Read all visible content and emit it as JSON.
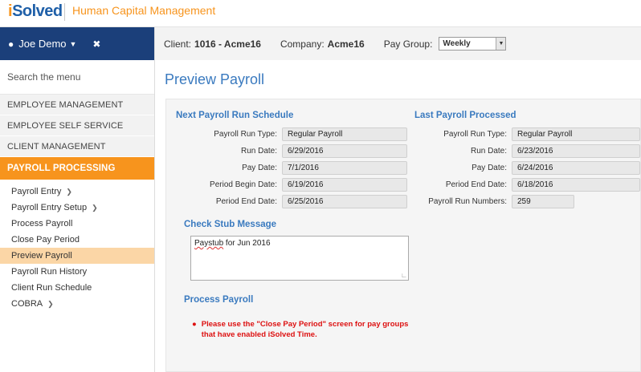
{
  "header": {
    "logo_i": "i",
    "logo_rest": "Solved",
    "app_title": "Human Capital Management"
  },
  "sidebar": {
    "user_name": "Joe Demo",
    "search_placeholder": "Search the menu",
    "categories": [
      {
        "label": "EMPLOYEE MANAGEMENT"
      },
      {
        "label": "EMPLOYEE SELF SERVICE"
      },
      {
        "label": "CLIENT MANAGEMENT"
      },
      {
        "label": "PAYROLL PROCESSING"
      }
    ],
    "items": [
      {
        "label": "Payroll Entry"
      },
      {
        "label": "Payroll Entry Setup"
      },
      {
        "label": "Process Payroll"
      },
      {
        "label": "Close Pay Period"
      },
      {
        "label": "Preview Payroll"
      },
      {
        "label": "Payroll Run History"
      },
      {
        "label": "Client Run Schedule"
      },
      {
        "label": "COBRA"
      }
    ]
  },
  "clientbar": {
    "client_label": "Client:",
    "client_value": "1016 - Acme16",
    "company_label": "Company:",
    "company_value": "Acme16",
    "paygroup_label": "Pay Group:",
    "paygroup_value": "Weekly"
  },
  "main": {
    "title": "Preview Payroll",
    "next": {
      "heading": "Next Payroll Run Schedule",
      "fields": [
        {
          "label": "Payroll Run Type:",
          "value": "Regular Payroll"
        },
        {
          "label": "Run Date:",
          "value": "6/29/2016"
        },
        {
          "label": "Pay Date:",
          "value": "7/1/2016"
        },
        {
          "label": "Period Begin Date:",
          "value": "6/19/2016"
        },
        {
          "label": "Period End Date:",
          "value": "6/25/2016"
        }
      ]
    },
    "last": {
      "heading": "Last Payroll Processed",
      "fields": [
        {
          "label": "Payroll Run Type:",
          "value": "Regular Payroll"
        },
        {
          "label": "Run Date:",
          "value": "6/23/2016"
        },
        {
          "label": "Pay Date:",
          "value": "6/24/2016"
        },
        {
          "label": "Period End Date:",
          "value": "6/18/2016"
        },
        {
          "label": "Payroll Run Numbers:",
          "value": "259"
        }
      ]
    },
    "stub": {
      "heading": "Check Stub Message",
      "word1": "Paystub",
      "rest": " for Jun 2016"
    },
    "process": {
      "heading": "Process Payroll",
      "warning_line1": "Please use the \"Close Pay Period\" screen for pay groups",
      "warning_line2": "that have enabled iSolved Time."
    }
  },
  "colors": {
    "brand_blue": "#1b3f7a",
    "accent_orange": "#f7941d",
    "heading_blue": "#3a7abf",
    "warning_red": "#dd1111"
  }
}
